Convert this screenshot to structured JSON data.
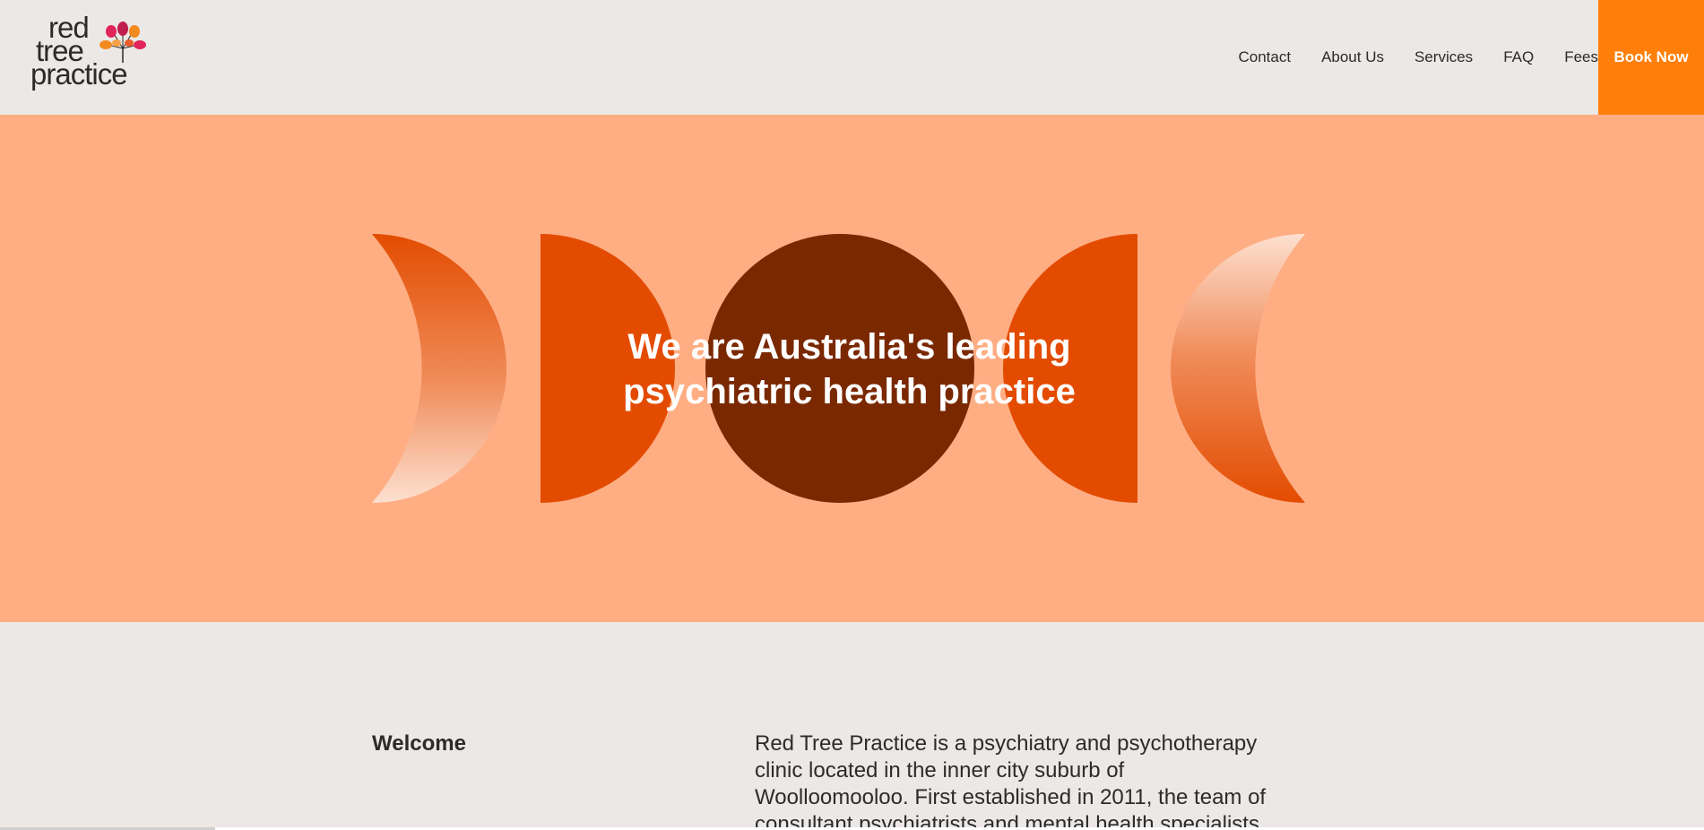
{
  "header": {
    "logo": {
      "line1": "red",
      "line2": "tree",
      "line3": "practice",
      "mark": "tree-logo-icon"
    },
    "nav": [
      {
        "label": "Contact"
      },
      {
        "label": "About Us"
      },
      {
        "label": "Services"
      },
      {
        "label": "FAQ"
      },
      {
        "label": "Fees"
      }
    ],
    "cta_label": "Book Now"
  },
  "hero": {
    "title_line1": "We are Australia's leading",
    "title_line2": "psychiatric health practice",
    "background_color": "#ffae84",
    "shape_colors": {
      "dark": "#7a2800",
      "orange": "#e34c00",
      "light": "#fcd5c0"
    }
  },
  "welcome": {
    "heading": "Welcome",
    "body": "Red Tree Practice is a psychiatry and psychotherapy clinic located in the inner city suburb of Woolloomooloo. First established in 2011, the team of consultant psychiatrists and mental health specialists"
  },
  "colors": {
    "accent": "#ff7f0a",
    "page_bg": "#ece8e5",
    "text": "#2b2b2b"
  }
}
